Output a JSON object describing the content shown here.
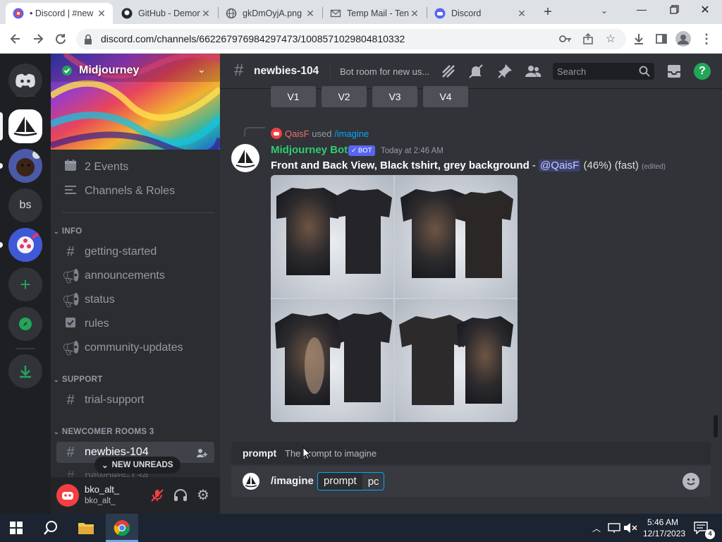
{
  "browser": {
    "tabs": [
      {
        "title": "• Discord | #new",
        "active": true,
        "icon": "discord-favicon"
      },
      {
        "title": "GitHub - Demon",
        "active": false,
        "icon": "github-favicon"
      },
      {
        "title": "gkDmOyjA.png",
        "active": false,
        "icon": "globe-favicon"
      },
      {
        "title": "Temp Mail - Ten",
        "active": false,
        "icon": "mail-favicon"
      },
      {
        "title": "Discord",
        "active": false,
        "icon": "discord-favicon"
      }
    ],
    "url": "discord.com/channels/662267976984297473/1008571029804810332"
  },
  "server": {
    "name": "Midjourney",
    "events": "2 Events",
    "channels_roles": "Channels & Roles",
    "categories": [
      {
        "name": "INFO",
        "channels": [
          "getting-started",
          "announcements",
          "status",
          "rules",
          "community-updates"
        ]
      },
      {
        "name": "SUPPORT",
        "channels": [
          "trial-support"
        ]
      },
      {
        "name": "NEWCOMER ROOMS 3",
        "channels": [
          "newbies-104",
          "newbies-134"
        ]
      }
    ],
    "new_unreads": "NEW UNREADS",
    "bs_label": "bs"
  },
  "user": {
    "name": "bko_alt_",
    "tag": "bko_alt_"
  },
  "channel": {
    "name": "newbies-104",
    "topic": "Bot room for new us...",
    "search_placeholder": "Search"
  },
  "messages": {
    "buttons": [
      "V1",
      "V2",
      "V3",
      "V4"
    ],
    "reply_user": "QaisF",
    "reply_used": "used",
    "reply_command": "/imagine",
    "author": "Midjourney Bot",
    "bot_tag": "BOT",
    "timestamp": "Today at 2:46 AM",
    "content_bold": "Front and Back View, Black tshirt, grey background",
    "content_dash": " - ",
    "mention": "@QaisF",
    "status": " (46%) (fast)",
    "edited": "(edited)"
  },
  "composer": {
    "hint_name": "prompt",
    "hint_desc": "The prompt to imagine",
    "command": "/imagine",
    "param": "prompt",
    "value": "pc"
  },
  "taskbar": {
    "time": "5:46 AM",
    "date": "12/17/2023",
    "notif_count": "4"
  },
  "colors": {
    "accent": "#5865f2",
    "link": "#00a8fc",
    "green": "#23a55a",
    "red": "#f23f43"
  }
}
